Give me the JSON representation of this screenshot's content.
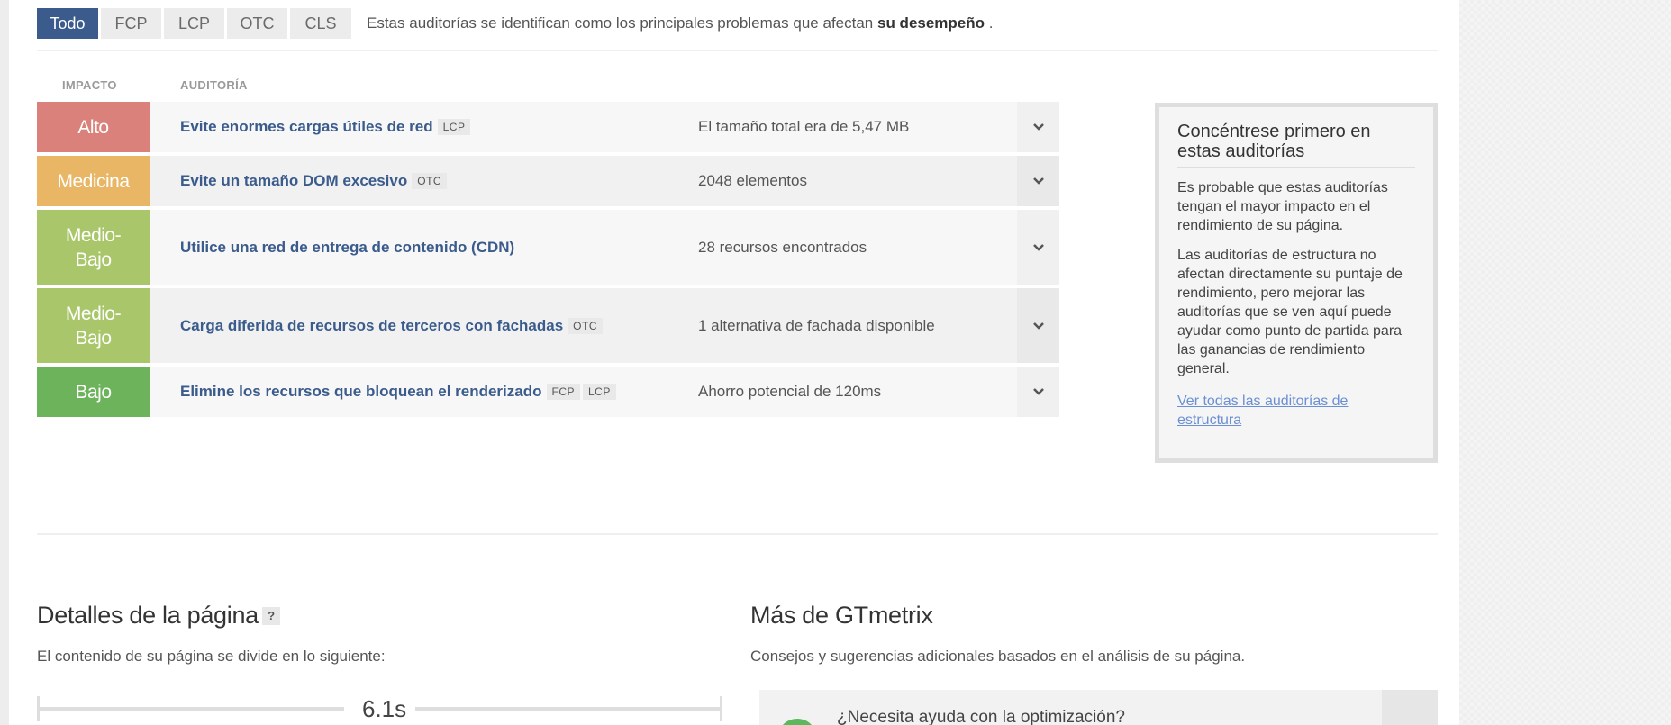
{
  "filters": {
    "tabs": [
      {
        "label": "Todo",
        "active": true
      },
      {
        "label": "FCP",
        "active": false
      },
      {
        "label": "LCP",
        "active": false
      },
      {
        "label": "OTC",
        "active": false
      },
      {
        "label": "CLS",
        "active": false
      }
    ],
    "description_prefix": "Estas auditorías se identifican como los principales problemas que afectan",
    "description_bold": "su desempeño",
    "description_suffix": "."
  },
  "columns": {
    "impact": "IMPACTO",
    "audit": "AUDITORÍA"
  },
  "audits": [
    {
      "impact": "Alto",
      "impact_color": "#d9817a",
      "title": "Evite enormes cargas útiles de red",
      "tags": [
        "LCP"
      ],
      "description": "El tamaño total era de 5,47 MB"
    },
    {
      "impact": "Medicina",
      "impact_color": "#e8b665",
      "title": "Evite un tamaño DOM excesivo",
      "tags": [
        "OTC"
      ],
      "description": "2048 elementos"
    },
    {
      "impact": "Medio-Bajo",
      "impact_color": "#a9c76a",
      "title": "Utilice una red de entrega de contenido (CDN)",
      "tags": [],
      "description": "28 recursos encontrados"
    },
    {
      "impact": "Medio-Bajo",
      "impact_color": "#a9c76a",
      "title": "Carga diferida de recursos de terceros con fachadas",
      "tags": [
        "OTC"
      ],
      "description": "1 alternativa de fachada disponible"
    },
    {
      "impact": "Bajo",
      "impact_color": "#6cb35b",
      "title": "Elimine los recursos que bloquean el renderizado",
      "tags": [
        "FCP",
        "LCP"
      ],
      "description": "Ahorro potencial de 120ms"
    }
  ],
  "sidebar": {
    "title": "Concéntrese primero en estas auditorías",
    "paragraph1": "Es probable que estas auditorías tengan el mayor impacto en el rendimiento de su página.",
    "paragraph2": "Las auditorías de estructura no afectan directamente su puntaje de rendimiento, pero mejorar las auditorías que se ven aquí puede ayudar como punto de partida para las ganancias de rendimiento general.",
    "link": "Ver todas las auditorías de estructura"
  },
  "page_details": {
    "title": "Detalles de la página",
    "help": "?",
    "subtitle": "El contenido de su página se divide en lo siguiente:",
    "timeline_value": "6.1s"
  },
  "more": {
    "title": "Más de GTmetrix",
    "subtitle": "Consejos y sugerencias adicionales basados en el análisis de su página.",
    "card_title": "¿Necesita ayuda con la optimización?"
  },
  "icons": {
    "expand": "chevron-down-icon"
  },
  "colors": {
    "brand": "#3a5b8c",
    "link": "#6a8fd4",
    "row_bg_odd": "#f7f7f7",
    "row_bg_even": "#f1f1f1",
    "expand_bg_odd": "#f0f0f0",
    "expand_bg_even": "#e9e9e9"
  }
}
